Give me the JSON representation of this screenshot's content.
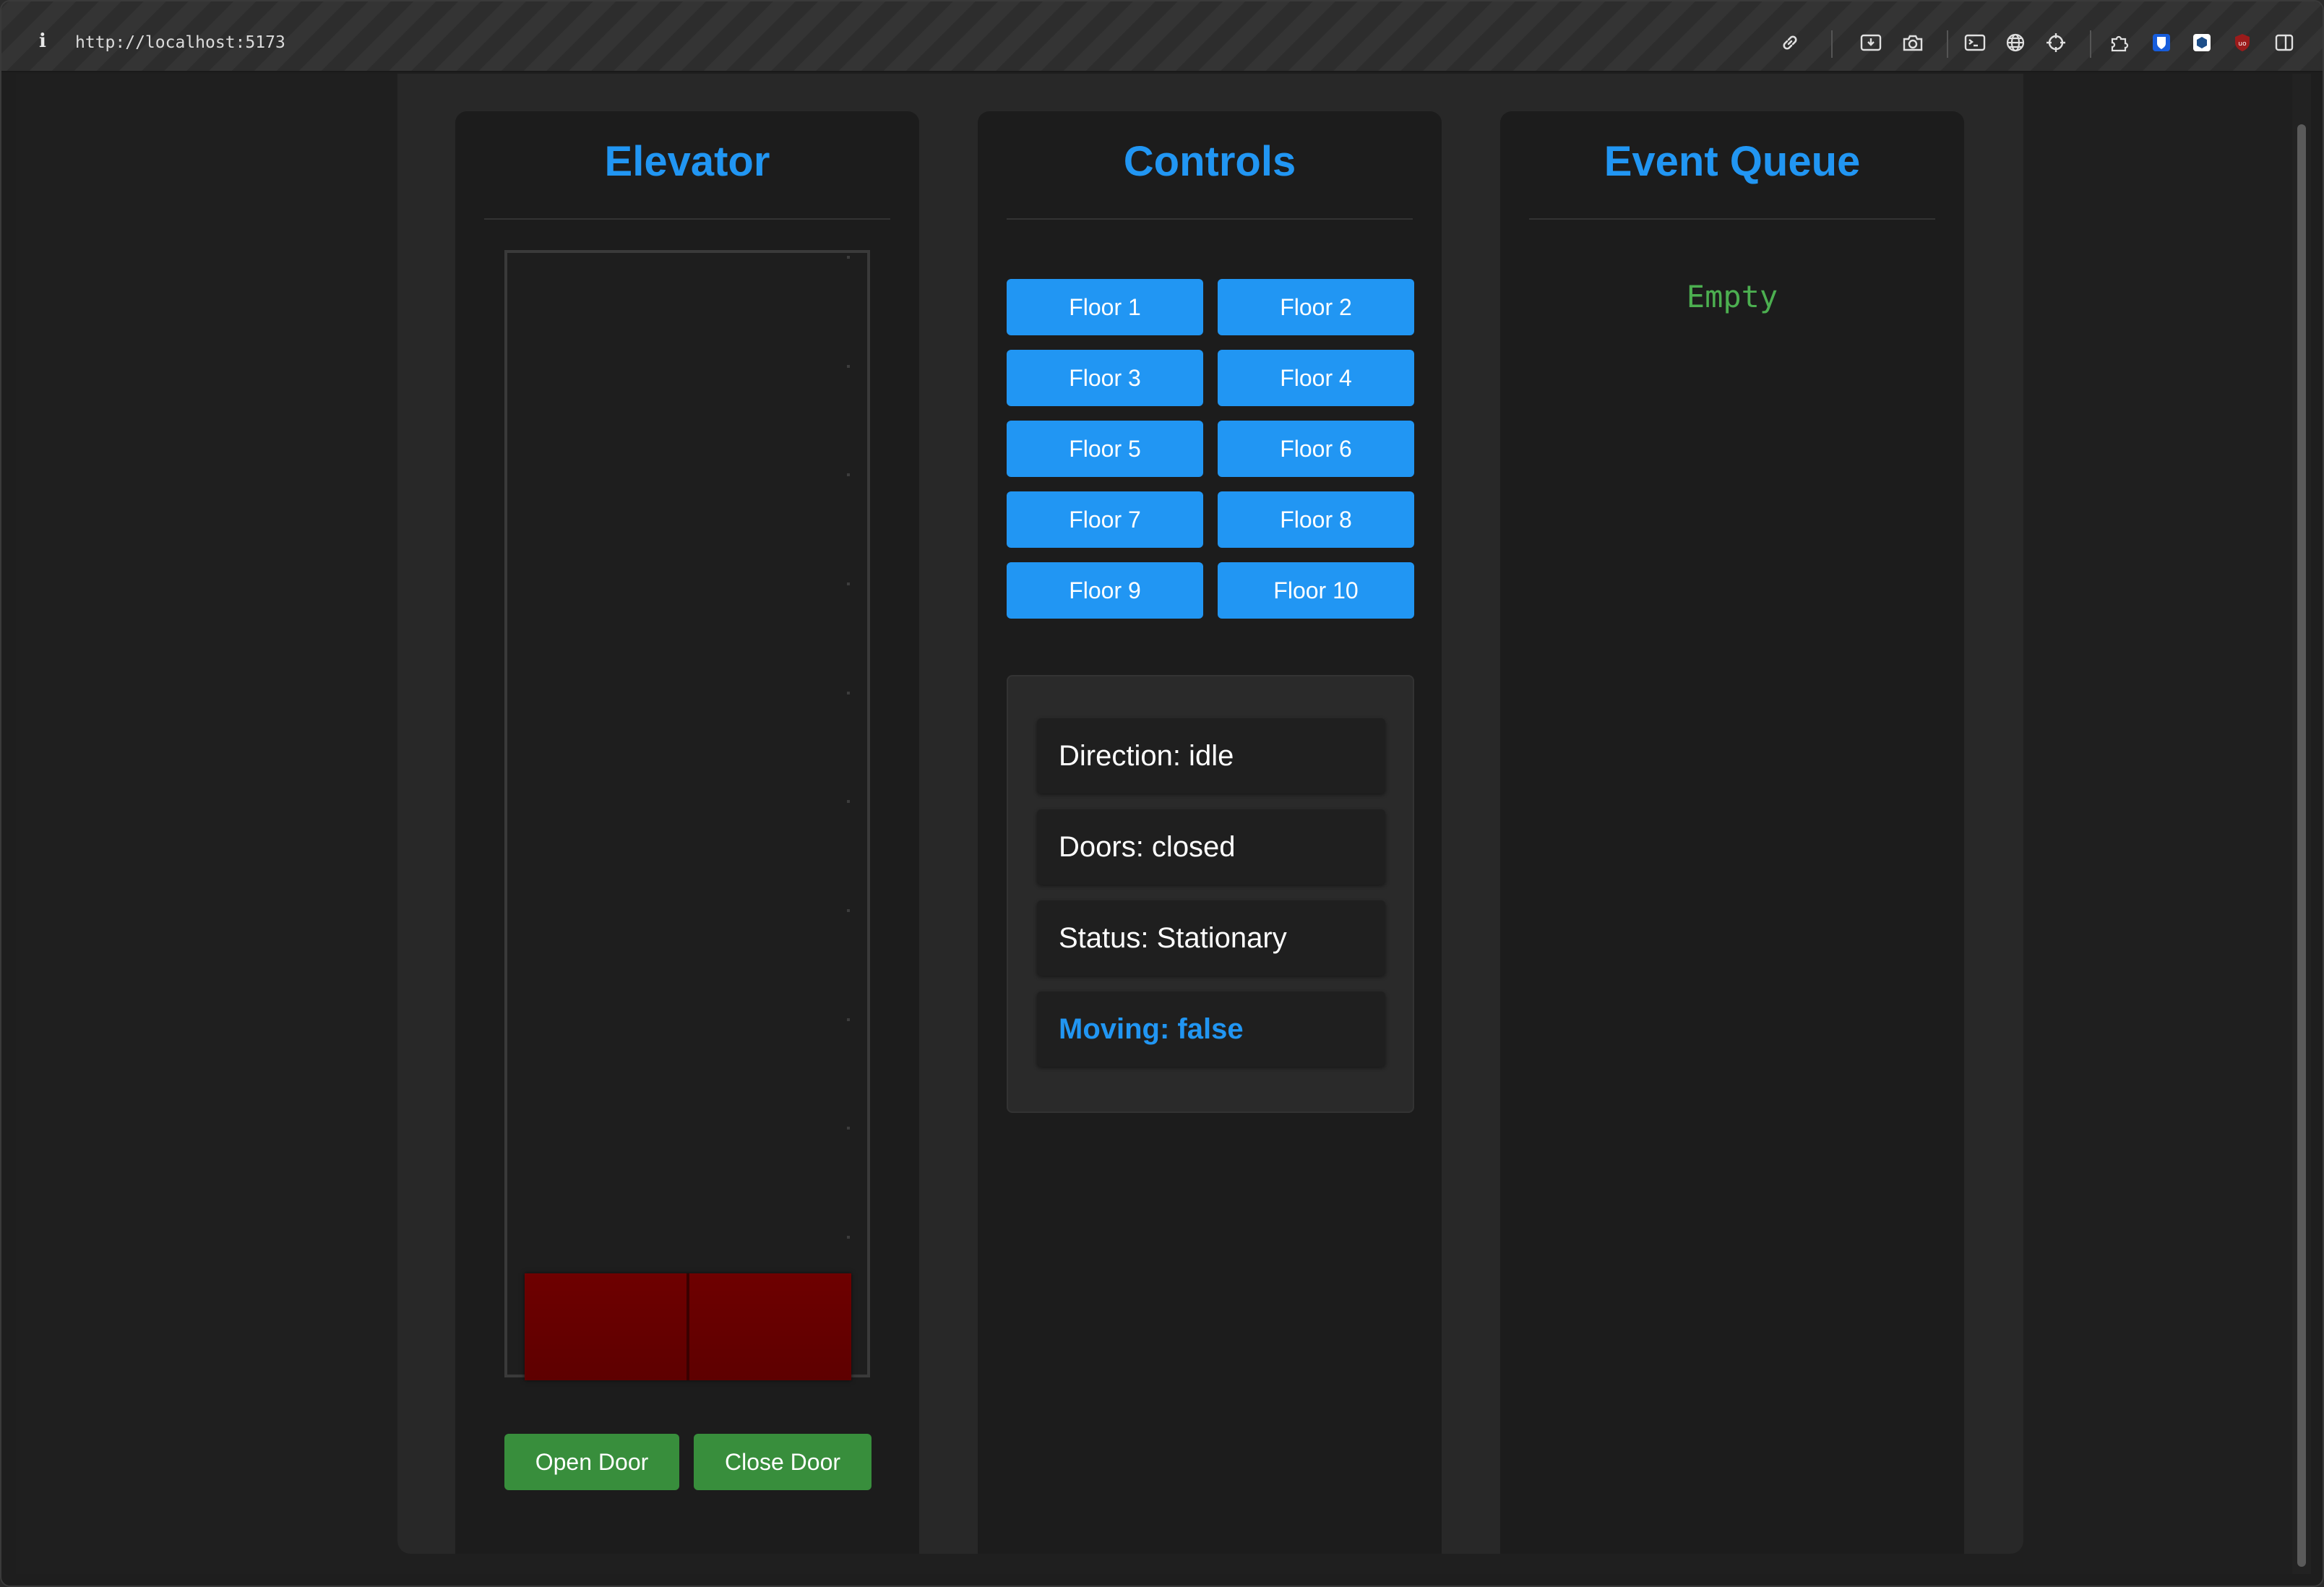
{
  "browser": {
    "url": "http://localhost:5173",
    "info_glyph": "i"
  },
  "elevator": {
    "title": "Elevator",
    "floor_count": 10,
    "open_door_label": "Open Door",
    "close_door_label": "Close Door",
    "car_color": "#6b0000"
  },
  "controls": {
    "title": "Controls",
    "floor_buttons": [
      "Floor 1",
      "Floor 2",
      "Floor 3",
      "Floor 4",
      "Floor 5",
      "Floor 6",
      "Floor 7",
      "Floor 8",
      "Floor 9",
      "Floor 10"
    ],
    "status": {
      "direction": "Direction: idle",
      "doors": "Doors: closed",
      "state": "Status: Stationary",
      "moving": "Moving: false"
    }
  },
  "event_queue": {
    "title": "Event Queue",
    "empty_text": "Empty"
  },
  "colors": {
    "accent_blue": "#2196f3",
    "button_green": "#388e3c",
    "queue_green": "#4caf50"
  }
}
